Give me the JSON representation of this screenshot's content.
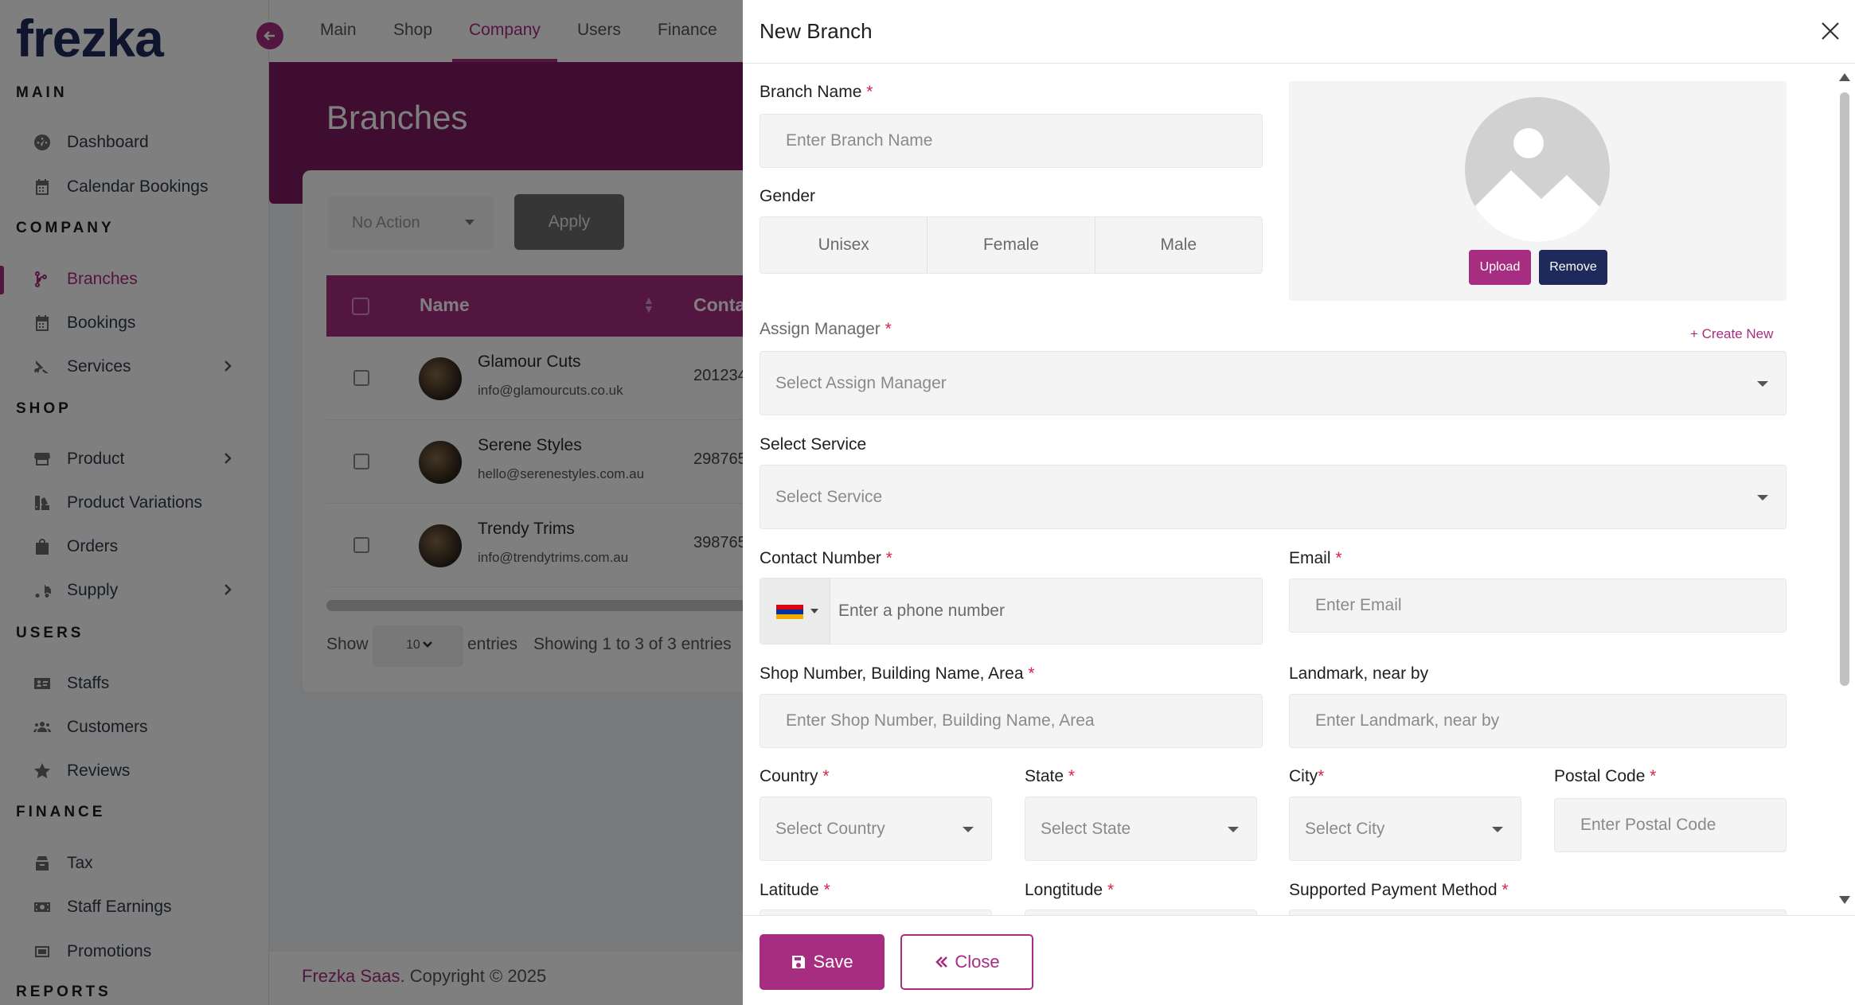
{
  "app": {
    "logo": "frezka"
  },
  "sidebar": {
    "sections": [
      {
        "title": "MAIN"
      },
      {
        "title": "COMPANY"
      },
      {
        "title": "SHOP"
      },
      {
        "title": "USERS"
      },
      {
        "title": "FINANCE"
      },
      {
        "title": "REPORTS"
      }
    ],
    "items": [
      {
        "label": "Dashboard",
        "icon": "dashboard-icon"
      },
      {
        "label": "Calendar Bookings",
        "icon": "calendar-icon"
      },
      {
        "label": "Branches",
        "icon": "branch-icon",
        "active": true
      },
      {
        "label": "Bookings",
        "icon": "calendar-icon"
      },
      {
        "label": "Services",
        "icon": "scissors-icon",
        "has_children": true
      },
      {
        "label": "Product",
        "icon": "store-icon",
        "has_children": true
      },
      {
        "label": "Product Variations",
        "icon": "variations-icon"
      },
      {
        "label": "Orders",
        "icon": "bag-icon"
      },
      {
        "label": "Supply",
        "icon": "truck-icon",
        "has_children": true
      },
      {
        "label": "Staffs",
        "icon": "id-card-icon"
      },
      {
        "label": "Customers",
        "icon": "users-icon"
      },
      {
        "label": "Reviews",
        "icon": "star-icon"
      },
      {
        "label": "Tax",
        "icon": "tax-icon"
      },
      {
        "label": "Staff Earnings",
        "icon": "money-icon"
      },
      {
        "label": "Promotions",
        "icon": "promotion-icon"
      }
    ]
  },
  "topbar": {
    "tabs": [
      {
        "label": "Main"
      },
      {
        "label": "Shop"
      },
      {
        "label": "Company",
        "active": true
      },
      {
        "label": "Users"
      },
      {
        "label": "Finance"
      }
    ]
  },
  "page": {
    "title": "Branches",
    "bulk_action": "No Action",
    "apply_label": "Apply",
    "table": {
      "columns": [
        "Name",
        "Conta"
      ],
      "rows": [
        {
          "name": "Glamour Cuts",
          "email": "info@glamourcuts.co.uk",
          "contact": "201234"
        },
        {
          "name": "Serene Styles",
          "email": "hello@serenestyles.com.au",
          "contact": "298765"
        },
        {
          "name": "Trendy Trims",
          "email": "info@trendytrims.com.au",
          "contact": "398765"
        }
      ]
    },
    "show_label": "Show",
    "page_length": "10",
    "entries_label": "entries",
    "info": "Showing 1 to 3 of 3 entries",
    "footer_brand": "Frezka Saas",
    "footer_text": ". Copyright © 2025"
  },
  "modal": {
    "title": "New Branch",
    "branch_name": {
      "label": "Branch Name",
      "required_mark": "*",
      "placeholder": "Enter Branch Name"
    },
    "gender": {
      "label": "Gender",
      "options": [
        "Unisex",
        "Female",
        "Male"
      ]
    },
    "image": {
      "upload_label": "Upload",
      "remove_label": "Remove"
    },
    "assign_manager": {
      "label": "Assign Manager",
      "required_mark": "*",
      "placeholder": "Select Assign Manager",
      "create_new": "+ Create New"
    },
    "service": {
      "label": "Select Service",
      "placeholder": "Select Service"
    },
    "contact": {
      "label": "Contact Number",
      "required_mark": "*",
      "placeholder": "Enter a phone number"
    },
    "email": {
      "label": "Email",
      "required_mark": "*",
      "placeholder": "Enter Email"
    },
    "shop_number": {
      "label": "Shop Number, Building Name, Area",
      "required_mark": "*",
      "placeholder": "Enter Shop Number, Building Name, Area"
    },
    "landmark": {
      "label": "Landmark, near by",
      "placeholder": "Enter Landmark, near by"
    },
    "country": {
      "label": "Country",
      "required_mark": "*",
      "placeholder": "Select Country"
    },
    "state": {
      "label": "State",
      "required_mark": "*",
      "placeholder": "Select State"
    },
    "city": {
      "label": "City",
      "required_mark": "*",
      "placeholder": "Select City"
    },
    "postal_code": {
      "label": "Postal Code",
      "required_mark": "*",
      "placeholder": "Enter Postal Code"
    },
    "latitude": {
      "label": "Latitude",
      "required_mark": "*"
    },
    "longitude": {
      "label": "Longtitude",
      "required_mark": "*"
    },
    "payment": {
      "label": "Supported Payment Method",
      "required_mark": "*"
    },
    "save_label": "Save",
    "close_label": "Close"
  },
  "colors": {
    "accent": "#a62d80",
    "navy": "#1e2a5a",
    "hero": "#7c1a5f"
  }
}
